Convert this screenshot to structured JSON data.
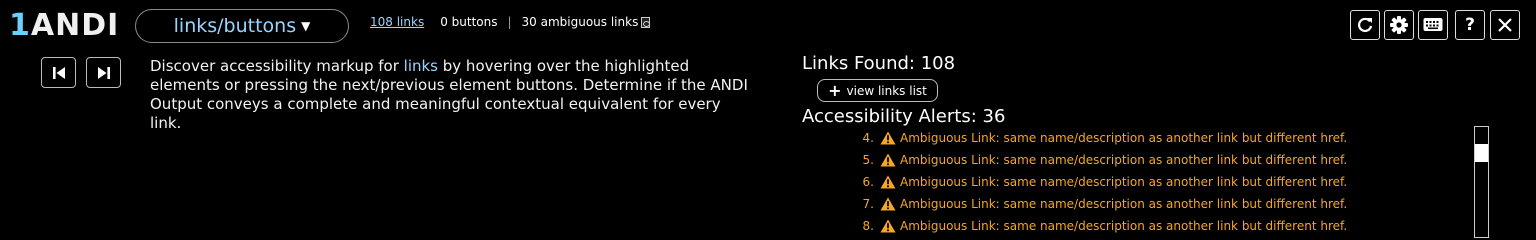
{
  "app": {
    "logo_number": "1",
    "logo_text": "ANDI"
  },
  "module_select": {
    "value": "links/buttons",
    "caret_icon": "caret-down-icon"
  },
  "counts": {
    "links": "108 links",
    "buttons": "0 buttons",
    "ambiguous": "30 ambiguous links"
  },
  "toolbar": {
    "icons": [
      "refresh-icon",
      "gear-icon",
      "keyboard-icon",
      "help-icon",
      "close-icon"
    ],
    "help_label": "?"
  },
  "nav": {
    "icons": [
      "previous-element-icon",
      "next-element-icon"
    ]
  },
  "instructions": {
    "before": "Discover accessibility markup for ",
    "link_word": "links",
    "after": " by hovering over the highlighted elements or pressing the next/previous element buttons. Determine if the ANDI Output conveys a complete and meaningful contextual equivalent for every link."
  },
  "summary": {
    "links_found": "Links Found: 108",
    "view_links_label": "view links list",
    "alerts_heading": "Accessibility Alerts: 36"
  },
  "alerts": [
    {
      "num": "4.",
      "text": "Ambiguous Link: same name/description as another link but different href."
    },
    {
      "num": "5.",
      "text": "Ambiguous Link: same name/description as another link but different href."
    },
    {
      "num": "6.",
      "text": "Ambiguous Link: same name/description as another link but different href."
    },
    {
      "num": "7.",
      "text": "Ambiguous Link: same name/description as another link but different href."
    },
    {
      "num": "8.",
      "text": "Ambiguous Link: same name/description as another link but different href."
    }
  ],
  "colors": {
    "accent": "#9ad5ff",
    "logo_accent": "#6ad1ff",
    "warning": "#f5a623",
    "background": "#000000"
  }
}
